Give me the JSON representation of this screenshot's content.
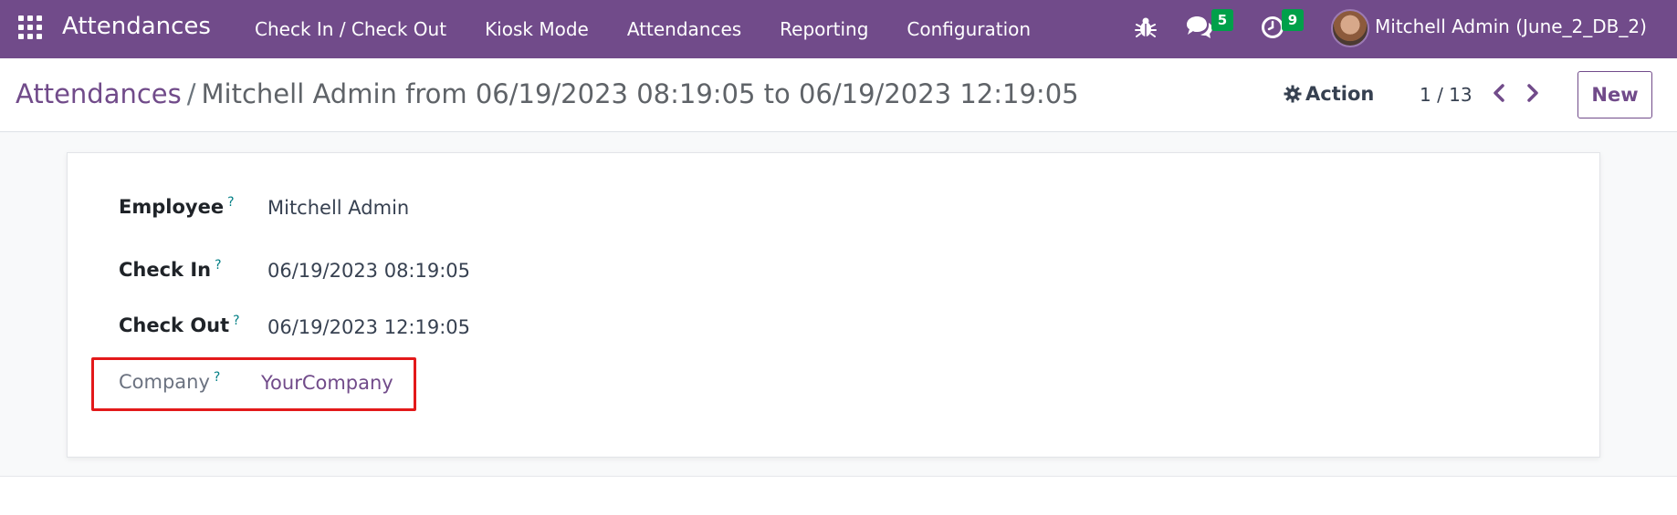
{
  "navbar": {
    "brand": "Attendances",
    "menu": [
      {
        "label": "Check In / Check Out"
      },
      {
        "label": "Kiosk Mode"
      },
      {
        "label": "Attendances"
      },
      {
        "label": "Reporting"
      },
      {
        "label": "Configuration"
      }
    ],
    "messages_count": "5",
    "activities_count": "9",
    "user": "Mitchell Admin (June_2_DB_2)",
    "colors": {
      "bar": "#714b8a",
      "badge": "#00a04a"
    }
  },
  "breadcrumb": {
    "root": "Attendances",
    "separator": "/",
    "current": "Mitchell Admin from 06/19/2023 08:19:05 to 06/19/2023 12:19:05"
  },
  "toolbar": {
    "action_label": "Action",
    "pager": "1 / 13",
    "new_label": "New"
  },
  "form": {
    "help_mark": "?",
    "fields": [
      {
        "label": "Employee",
        "value": "Mitchell Admin"
      },
      {
        "label": "Check In",
        "value": "06/19/2023 08:19:05"
      },
      {
        "label": "Check Out",
        "value": "06/19/2023 12:19:05"
      },
      {
        "label": "Company",
        "value": "YourCompany"
      }
    ]
  },
  "icons": [
    "apps-icon",
    "bug-icon",
    "chat-icon",
    "clock-icon",
    "gear-icon",
    "chevron-left-icon",
    "chevron-right-icon"
  ]
}
